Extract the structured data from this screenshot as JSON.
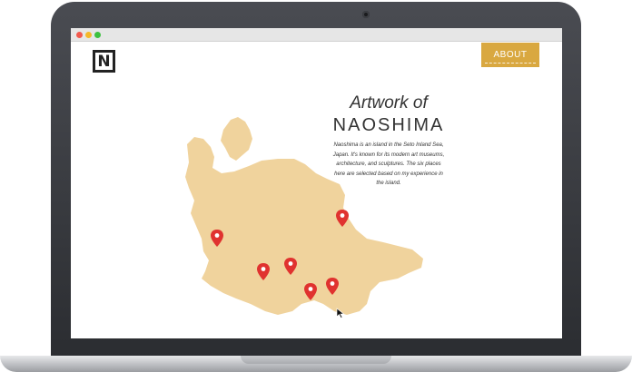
{
  "window": {
    "controls": [
      "close",
      "minimize",
      "maximize"
    ]
  },
  "header": {
    "logo_letter": "N",
    "about_label": "ABOUT"
  },
  "hero": {
    "title_line1": "Artwork of",
    "title_line2": "NAOSHIMA",
    "description": "Naoshima is an island in the Seto Inland Sea, Japan. It's known for its modern art museums, architecture, and sculptures. The six places here are selected based on my experience in the island."
  },
  "map": {
    "island_color": "#f0d39d",
    "pin_color": "#e0322f",
    "pin_count": 6
  },
  "colors": {
    "accent": "#d9a840",
    "laptop_frame": "#2b2d31"
  }
}
